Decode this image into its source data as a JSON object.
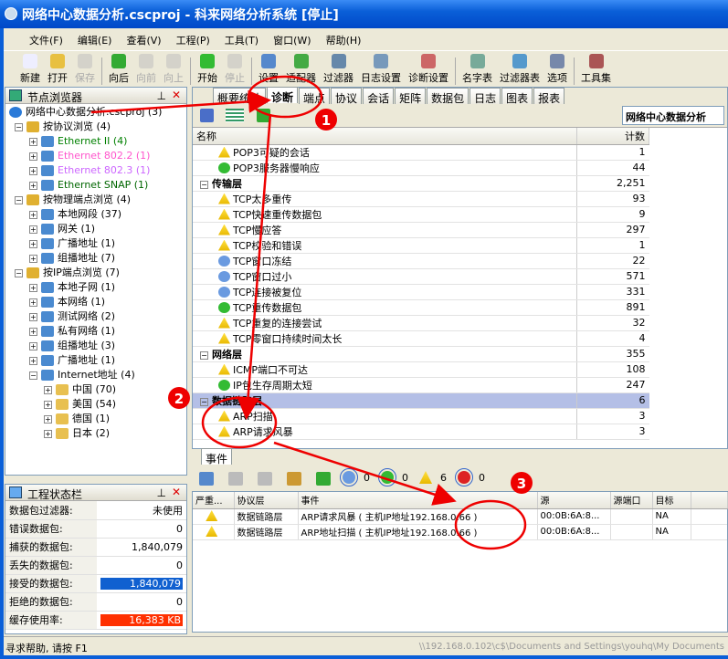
{
  "window": {
    "title": "网络中心数据分析.cscproj - 科来网络分析系统 [停止]"
  },
  "menu": [
    "文件(F)",
    "编辑(E)",
    "查看(V)",
    "工程(P)",
    "工具(T)",
    "窗口(W)",
    "帮助(H)"
  ],
  "toolbar": [
    {
      "label": "新建",
      "icon": "new-icon",
      "enabled": true
    },
    {
      "label": "打开",
      "icon": "open-icon",
      "enabled": true
    },
    {
      "label": "保存",
      "icon": "save-icon",
      "enabled": false
    },
    {
      "label": "向后",
      "icon": "back-icon",
      "enabled": true
    },
    {
      "label": "向前",
      "icon": "forward-icon",
      "enabled": false
    },
    {
      "label": "向上",
      "icon": "up-icon",
      "enabled": false
    },
    {
      "label": "开始",
      "icon": "start-icon",
      "enabled": true
    },
    {
      "label": "停止",
      "icon": "stop-icon",
      "enabled": false
    },
    {
      "label": "设置",
      "icon": "settings-icon",
      "enabled": true
    },
    {
      "label": "适配器",
      "icon": "adapter-icon",
      "enabled": true
    },
    {
      "label": "过滤器",
      "icon": "filter-icon",
      "enabled": true
    },
    {
      "label": "日志设置",
      "icon": "log-settings-icon",
      "enabled": true
    },
    {
      "label": "诊断设置",
      "icon": "diagnosis-settings-icon",
      "enabled": true
    },
    {
      "label": "名字表",
      "icon": "name-table-icon",
      "enabled": true
    },
    {
      "label": "过滤器表",
      "icon": "filter-table-icon",
      "enabled": true
    },
    {
      "label": "选项",
      "icon": "options-icon",
      "enabled": true
    },
    {
      "label": "工具集",
      "icon": "toolset-icon",
      "enabled": true
    }
  ],
  "node_browser": {
    "title": "节点浏览器",
    "items": [
      {
        "label": "网络中心数据分析.cscproj (3)",
        "level": 0,
        "color": "#000000"
      },
      {
        "label": "按协议浏览 (4)",
        "level": 1,
        "color": "#000000",
        "expanded": true
      },
      {
        "label": "Ethernet II (4)",
        "level": 2,
        "color": "#008000"
      },
      {
        "label": "Ethernet 802.2 (1)",
        "level": 2,
        "color": "#ff55cc"
      },
      {
        "label": "Ethernet 802.3 (1)",
        "level": 2,
        "color": "#cc66ff"
      },
      {
        "label": "Ethernet SNAP (1)",
        "level": 2,
        "color": "#006600"
      },
      {
        "label": "按物理端点浏览 (4)",
        "level": 1,
        "color": "#000000",
        "expanded": true
      },
      {
        "label": "本地网段 (37)",
        "level": 2,
        "color": "#000000"
      },
      {
        "label": "网关 (1)",
        "level": 2,
        "color": "#000000"
      },
      {
        "label": "广播地址 (1)",
        "level": 2,
        "color": "#000000"
      },
      {
        "label": "组播地址 (7)",
        "level": 2,
        "color": "#000000"
      },
      {
        "label": "按IP端点浏览 (7)",
        "level": 1,
        "color": "#000000",
        "expanded": true
      },
      {
        "label": "本地子网 (1)",
        "level": 2,
        "color": "#000000"
      },
      {
        "label": "本网络 (1)",
        "level": 2,
        "color": "#000000"
      },
      {
        "label": "测试网络 (2)",
        "level": 2,
        "color": "#000000"
      },
      {
        "label": "私有网络 (1)",
        "level": 2,
        "color": "#000000"
      },
      {
        "label": "组播地址 (3)",
        "level": 2,
        "color": "#000000"
      },
      {
        "label": "广播地址 (1)",
        "level": 2,
        "color": "#000000"
      },
      {
        "label": "Internet地址 (4)",
        "level": 2,
        "color": "#000000",
        "expanded": true
      },
      {
        "label": "中国 (70)",
        "level": 3,
        "color": "#000000"
      },
      {
        "label": "美国 (54)",
        "level": 3,
        "color": "#000000"
      },
      {
        "label": "德国 (1)",
        "level": 3,
        "color": "#000000"
      },
      {
        "label": "日本 (2)",
        "level": 3,
        "color": "#000000"
      }
    ]
  },
  "project_status": {
    "title": "工程状态栏",
    "rows": [
      {
        "label": "数据包过滤器:",
        "value": "未使用"
      },
      {
        "label": "错误数据包:",
        "value": "0"
      },
      {
        "label": "捕获的数据包:",
        "value": "1,840,079"
      },
      {
        "label": "丢失的数据包:",
        "value": "0"
      },
      {
        "label": "接受的数据包:",
        "value": "1,840,079",
        "highlight": "#1060d0"
      },
      {
        "label": "拒绝的数据包:",
        "value": "0"
      },
      {
        "label": "缓存使用率:",
        "value": "16,383 KB",
        "highlight": "#ff3000"
      }
    ]
  },
  "tabs": [
    "概要统计",
    "诊断",
    "端点",
    "协议",
    "会话",
    "矩阵",
    "数据包",
    "日志",
    "图表",
    "报表"
  ],
  "active_tab": "诊断",
  "node_selector": "网络中心数据分析",
  "diagnosis": {
    "columns": [
      "名称",
      "计数"
    ],
    "rows": [
      {
        "name": "POP3可疑的会话",
        "count": "1",
        "type": "warn"
      },
      {
        "name": "POP3服务器慢响应",
        "count": "44",
        "type": "ok"
      },
      {
        "name": "传输层",
        "count": "2,251",
        "type": "group"
      },
      {
        "name": "TCP太多重传",
        "count": "93",
        "type": "warn"
      },
      {
        "name": "TCP快速重传数据包",
        "count": "9",
        "type": "warn"
      },
      {
        "name": "TCP慢应答",
        "count": "297",
        "type": "warn"
      },
      {
        "name": "TCP校验和错误",
        "count": "1",
        "type": "warn"
      },
      {
        "name": "TCP窗口冻结",
        "count": "22",
        "type": "info"
      },
      {
        "name": "TCP窗口过小",
        "count": "571",
        "type": "info"
      },
      {
        "name": "TCP连接被复位",
        "count": "331",
        "type": "info"
      },
      {
        "name": "TCP重传数据包",
        "count": "891",
        "type": "ok"
      },
      {
        "name": "TCP重复的连接尝试",
        "count": "32",
        "type": "warn"
      },
      {
        "name": "TCP零窗口持续时间太长",
        "count": "4",
        "type": "warn"
      },
      {
        "name": "网络层",
        "count": "355",
        "type": "group"
      },
      {
        "name": "ICMP端口不可达",
        "count": "108",
        "type": "warn"
      },
      {
        "name": "IP包生存周期太短",
        "count": "247",
        "type": "ok"
      },
      {
        "name": "数据链路层",
        "count": "6",
        "type": "group",
        "selected": true
      },
      {
        "name": "ARP扫描",
        "count": "3",
        "type": "warn"
      },
      {
        "name": "ARP请求风暴",
        "count": "3",
        "type": "warn"
      }
    ]
  },
  "events": {
    "tab": "事件",
    "counts": {
      "info": "0",
      "ok": "0",
      "warn": "6",
      "error": "0"
    },
    "columns": [
      "严重...",
      "协议层",
      "事件",
      "源",
      "源端口",
      "目标",
      ""
    ],
    "rows": [
      {
        "layer": "数据链路层",
        "event": "ARP请求风暴 ( 主机IP地址192.168.0.66 )",
        "src": "00:0B:6A:8...",
        "sport": "",
        "dst": "NA"
      },
      {
        "layer": "数据链路层",
        "event": "ARP地址扫描 ( 主机IP地址192.168.0.66 )",
        "src": "00:0B:6A:8...",
        "sport": "",
        "dst": "NA"
      }
    ]
  },
  "annotations": [
    "1",
    "2",
    "3"
  ],
  "statusbar": {
    "help": "寻求帮助, 请按 F1",
    "path": "\\\\192.168.0.102\\c$\\Documents and Settings\\youhq\\My Documents"
  }
}
